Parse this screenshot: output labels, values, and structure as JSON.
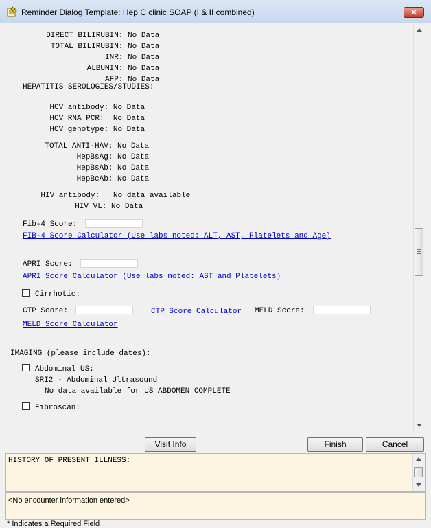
{
  "window": {
    "title": "Reminder Dialog Template: Hep C clinic SOAP (I & II combined)",
    "close_label": "✕",
    "icon": "notepad-icon"
  },
  "labs": [
    {
      "name": "DIRECT BILIRUBIN:",
      "value": "No Data"
    },
    {
      "name": "TOTAL BILIRUBIN:",
      "value": "No Data"
    },
    {
      "name": "INR:",
      "value": "No Data"
    },
    {
      "name": "ALBUMIN:",
      "value": "No Data"
    },
    {
      "name": "AFP:",
      "value": "No Data"
    }
  ],
  "serologies": {
    "heading": "HEPATITIS SEROLOGIES/STUDIES:",
    "items": [
      {
        "name": "HCV antibody:",
        "value": "No Data"
      },
      {
        "name": "HCV RNA PCR:",
        "value": "No Data"
      },
      {
        "name": "HCV genotype:",
        "value": "No Data"
      }
    ]
  },
  "hav_hbv": [
    {
      "name": "TOTAL ANTI-HAV:",
      "value": "No Data"
    },
    {
      "name": "HepBsAg:",
      "value": "No Data"
    },
    {
      "name": "HepBsAb:",
      "value": "No Data"
    },
    {
      "name": "HepBcAb:",
      "value": "No Data"
    }
  ],
  "hiv": {
    "antibody_label": "HIV antibody:",
    "antibody_value": "No data available",
    "vl_label": "HIV VL:",
    "vl_value": "No Data"
  },
  "fib4": {
    "label": "Fib-4 Score:",
    "value": "",
    "link": "FIB-4 Score Calculator (Use labs noted: ALT, AST, Platelets and Age)"
  },
  "apri": {
    "label": "APRI Score:",
    "value": "",
    "link": "APRI Score Calculator (Use labs noted: AST and Platelets)"
  },
  "cirrhotic": {
    "label": "Cirrhotic:",
    "checked": false
  },
  "ctp": {
    "label": "CTP Score:",
    "value": "",
    "link": "CTP Score Calculator"
  },
  "meld": {
    "label": "MELD Score:",
    "value": "",
    "link": "MELD Score Calculator"
  },
  "imaging": {
    "heading": "IMAGING (please include dates):",
    "abdominal_us": {
      "label": "Abdominal US:",
      "checked": false,
      "detail1": "SRI2 - Abdominal Ultrasound",
      "detail2": "No data available for US ABDOMEN COMPLETE"
    },
    "fibroscan": {
      "label": "Fibroscan:",
      "checked": false
    }
  },
  "buttons": {
    "visit_info": "Visit Info",
    "finish": "Finish",
    "cancel": "Cancel"
  },
  "notes_text": "HISTORY OF PRESENT ILLNESS:",
  "encounter_text": "<No encounter information entered>",
  "footer_text": "* Indicates a Required Field"
}
